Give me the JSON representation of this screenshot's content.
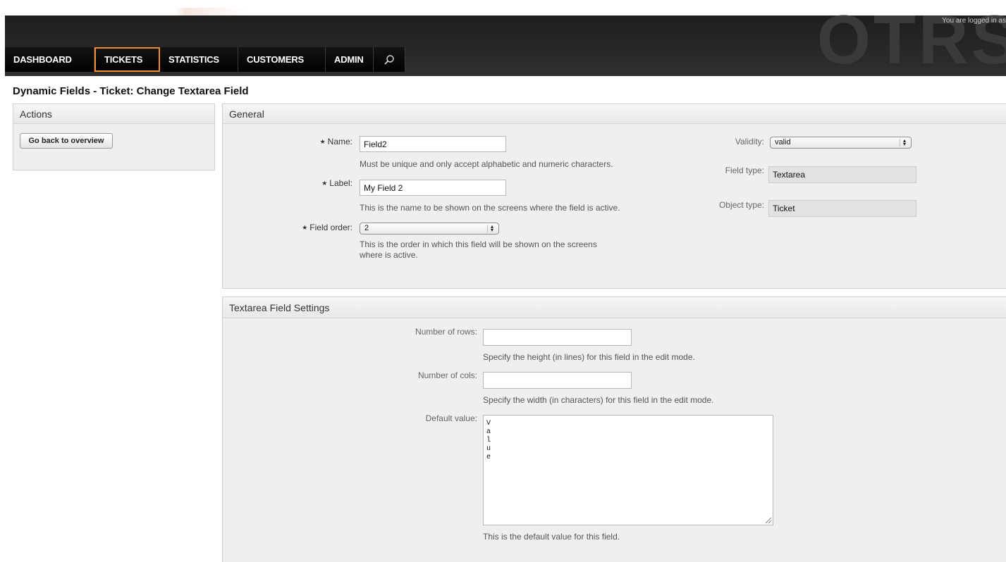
{
  "header": {
    "logo": "OTRS",
    "login_text": "You are logged in as",
    "nav": [
      {
        "label": "Dashboard"
      },
      {
        "label": "Tickets"
      },
      {
        "label": "Statistics"
      },
      {
        "label": "Customers"
      },
      {
        "label": "Admin"
      }
    ],
    "active_nav": "Tickets",
    "accent_color": "#f08c2a"
  },
  "page": {
    "title": "Dynamic Fields - Ticket: Change Textarea Field"
  },
  "actions": {
    "title": "Actions",
    "back_button": "Go back to overview"
  },
  "general": {
    "title": "General",
    "name": {
      "label": "Name:",
      "value": "Field2",
      "hint": "Must be unique and only accept alphabetic and numeric characters."
    },
    "label": {
      "label": "Label:",
      "value": "My Field 2",
      "hint": "This is the name to be shown on the screens where the field is active."
    },
    "field_order": {
      "label": "Field order:",
      "value": "2",
      "hint_line1": "This is the order in which this field will be shown on the screens",
      "hint_line2": "where is active."
    },
    "validity": {
      "label": "Validity:",
      "value": "valid"
    },
    "field_type": {
      "label": "Field type:",
      "value": "Textarea"
    },
    "object_type": {
      "label": "Object type:",
      "value": "Ticket"
    }
  },
  "textarea_settings": {
    "title": "Textarea Field Settings",
    "rows": {
      "label": "Number of rows:",
      "value": "",
      "hint": "Specify the height (in lines) for this field in the edit mode."
    },
    "cols": {
      "label": "Number of cols:",
      "value": "",
      "hint": "Specify the width (in characters) for this field in the edit mode."
    },
    "default_value": {
      "label": "Default value:",
      "value": "V\na\nl\nu\ne",
      "hint": "This is the default value for this field."
    }
  }
}
